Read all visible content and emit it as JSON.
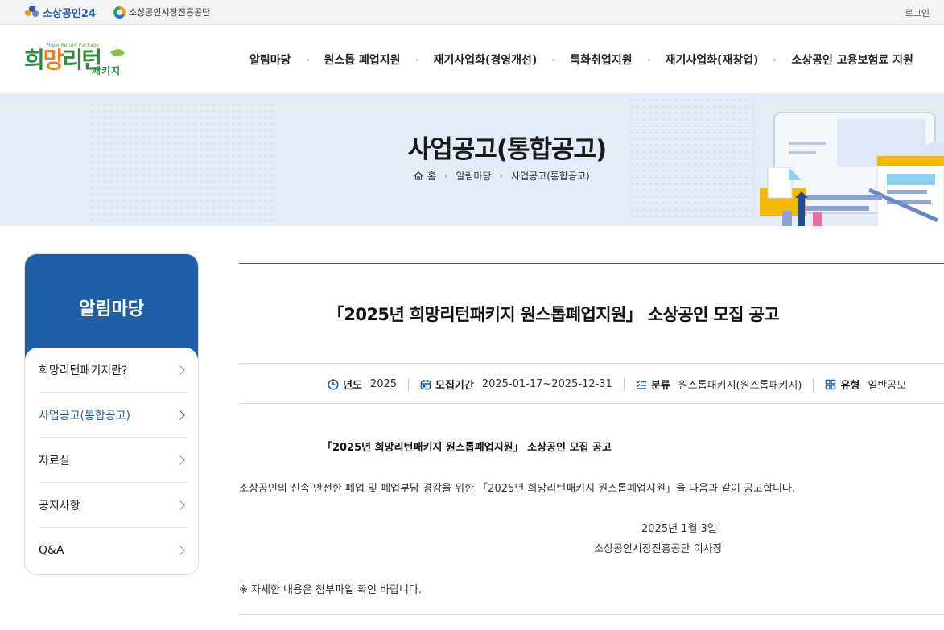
{
  "utility": {
    "brand1": "소상공인24",
    "brand2": "소상공인시장진흥공단",
    "login": "로그인"
  },
  "logo": {
    "tagline": "Hope Return Package",
    "main_a": "희",
    "main_b": "망",
    "main_c": "리턴",
    "sub": "패키지"
  },
  "gnb": [
    "알림마당",
    "원스톱 폐업지원",
    "재기사업화(경영개선)",
    "특화취업지원",
    "재기사업화(재창업)",
    "소상공인 고용보험료 지원"
  ],
  "banner": {
    "title": "사업공고(통합공고)",
    "breadcrumb": [
      "홈",
      "알림마당",
      "사업공고(통합공고)"
    ]
  },
  "sidebar": {
    "title": "알림마당",
    "items": [
      {
        "label": "희망리턴패키지란?"
      },
      {
        "label": "사업공고(통합공고)"
      },
      {
        "label": "자료실"
      },
      {
        "label": "공지사항"
      },
      {
        "label": "Q&A"
      }
    ],
    "active_index": 1
  },
  "post": {
    "title": "「2025년 희망리턴패키지 원스톱폐업지원」 소상공인 모집 공고",
    "meta": {
      "year_label": "년도",
      "year_value": "2025",
      "period_label": "모집기간",
      "period_value": "2025-01-17~2025-12-31",
      "category_label": "분류",
      "category_value": "원스톱패키지(원스톱패키지)",
      "type_label": "유형",
      "type_value": "일반공모"
    },
    "body": {
      "heading": "「2025년 희망리턴패키지 원스톱폐업지원」 소상공인 모집 공고",
      "paragraph": "소상공인의 신속·안전한 폐업 및 폐업부담 경감을 위한 「2025년 희망리턴패키지 원스톱폐업지원」을 다음과 같이 공고합니다.",
      "date": "2025년 1월 3일",
      "signature": "소상공인시장진흥공단 이사장",
      "note": "※ 자세한 내용은 첨부파일 확인 바랍니다."
    }
  },
  "colors": {
    "primary": "#1f5fa8",
    "banner_bg": "#e3ecf7",
    "logo_green": "#2d8a3e",
    "logo_orange": "#e67e22"
  }
}
